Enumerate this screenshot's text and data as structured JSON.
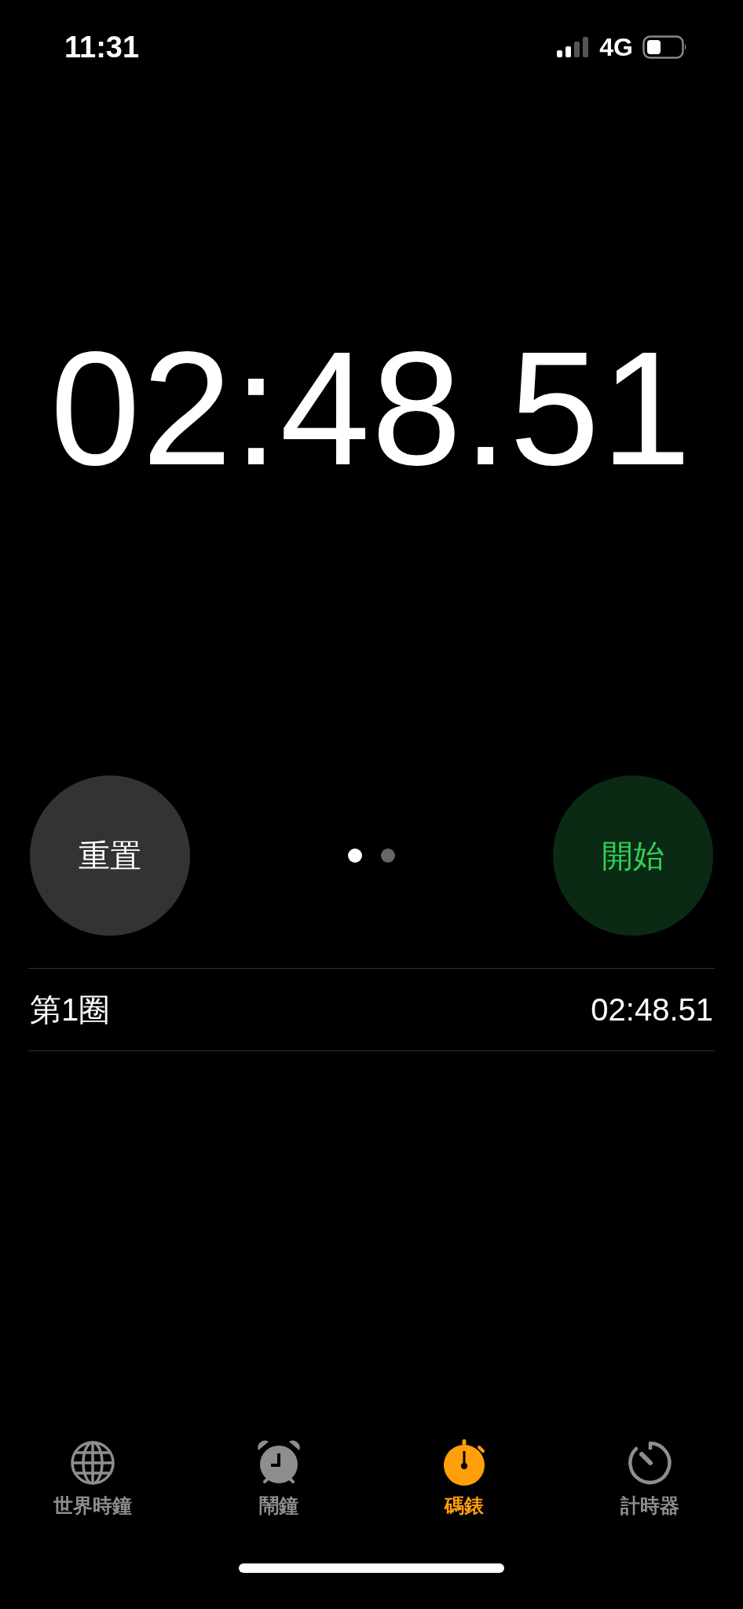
{
  "status_bar": {
    "time": "11:31",
    "network": "4G"
  },
  "stopwatch": {
    "elapsed": "02:48.51"
  },
  "controls": {
    "reset_button": "重置",
    "start_button": "開始"
  },
  "page_dots": [
    {
      "selected": true
    },
    {
      "selected": false
    }
  ],
  "laps": [
    {
      "label": "第1圈",
      "time": "02:48.51"
    }
  ],
  "tab_bar": [
    {
      "label": "世界時鐘",
      "kind": "globe",
      "selected": false
    },
    {
      "label": "鬧鐘",
      "kind": "alarm",
      "selected": false
    },
    {
      "label": "碼錶",
      "kind": "stopwatch",
      "selected": true
    },
    {
      "label": "計時器",
      "kind": "timer",
      "selected": false
    }
  ]
}
